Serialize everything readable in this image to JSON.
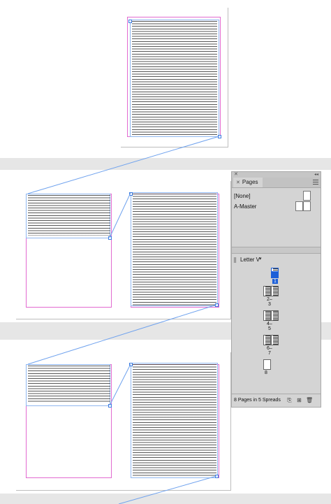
{
  "pages_panel": {
    "tab_label": "Pages",
    "masters": [
      {
        "label": "[None]"
      },
      {
        "label": "A-Master"
      }
    ],
    "page_size": "Letter V",
    "spreads": [
      {
        "label": "1",
        "selected": true
      },
      {
        "label": "2–3"
      },
      {
        "label": "4–5"
      },
      {
        "label": "6–7"
      },
      {
        "label": "8"
      }
    ],
    "status": "8 Pages in 5 Spreads"
  },
  "icons": {
    "close": "close-icon",
    "menu": "panel-menu-icon",
    "new_page": "new-page-icon",
    "edit_size": "edit-page-size-icon",
    "delete": "trash-icon"
  },
  "colors": {
    "margin": "#e26ad0",
    "frame": "#8fb7f0",
    "thread": "#6fa2ee",
    "selection": "#1c5fd8"
  }
}
